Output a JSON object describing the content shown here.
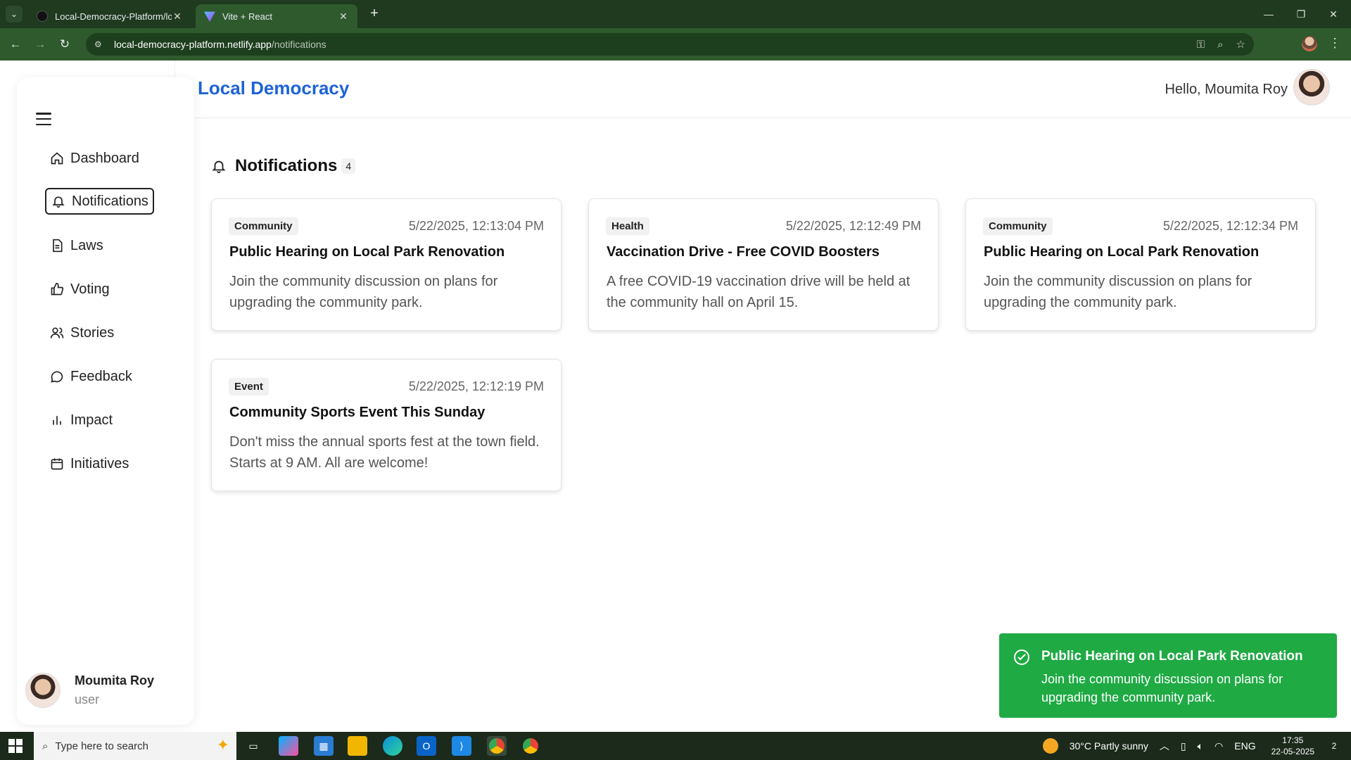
{
  "browser": {
    "tabs": [
      {
        "title": "Local-Democracy-Platform/loca",
        "active": false
      },
      {
        "title": "Vite + React",
        "active": true
      }
    ],
    "url_host": "local-democracy-platform.netlify.app",
    "url_path": "/notifications"
  },
  "app": {
    "brand": "Local Democracy",
    "greeting": "Hello, Moumita Roy"
  },
  "sidebar": {
    "items": [
      {
        "label": "Dashboard",
        "icon": "home-icon"
      },
      {
        "label": "Notifications",
        "icon": "bell-icon",
        "active": true
      },
      {
        "label": "Laws",
        "icon": "document-icon"
      },
      {
        "label": "Voting",
        "icon": "thumbs-up-icon"
      },
      {
        "label": "Stories",
        "icon": "users-icon"
      },
      {
        "label": "Feedback",
        "icon": "chat-bubble-icon"
      },
      {
        "label": "Impact",
        "icon": "bar-chart-icon"
      },
      {
        "label": "Initiatives",
        "icon": "calendar-icon"
      }
    ],
    "user": {
      "name": "Moumita Roy",
      "role": "user"
    }
  },
  "notifications": {
    "title": "Notifications",
    "count": "4",
    "items": [
      {
        "tag": "Community",
        "time": "5/22/2025, 12:13:04 PM",
        "title": "Public Hearing on Local Park Renovation",
        "body": "Join the community discussion on plans for upgrading the community park."
      },
      {
        "tag": "Health",
        "time": "5/22/2025, 12:12:49 PM",
        "title": "Vaccination Drive - Free COVID Boosters",
        "body": "A free COVID-19 vaccination drive will be held at the community hall on April 15."
      },
      {
        "tag": "Community",
        "time": "5/22/2025, 12:12:34 PM",
        "title": "Public Hearing on Local Park Renovation",
        "body": "Join the community discussion on plans for upgrading the community park."
      },
      {
        "tag": "Event",
        "time": "5/22/2025, 12:12:19 PM",
        "title": "Community Sports Event This Sunday",
        "body": "Don't miss the annual sports fest at the town field. Starts at 9 AM. All are welcome!"
      }
    ]
  },
  "toast": {
    "title": "Public Hearing on Local Park Renovation",
    "body": "Join the community discussion on plans for upgrading the community park.",
    "color": "#1faa44"
  },
  "taskbar": {
    "search_placeholder": "Type here to search",
    "weather": "30°C  Partly sunny",
    "lang": "ENG",
    "time": "17:35",
    "date": "22-05-2025",
    "notif_count": "2"
  },
  "colors": {
    "brand": "#1d63d6",
    "chrome": "#2e5a2e"
  }
}
